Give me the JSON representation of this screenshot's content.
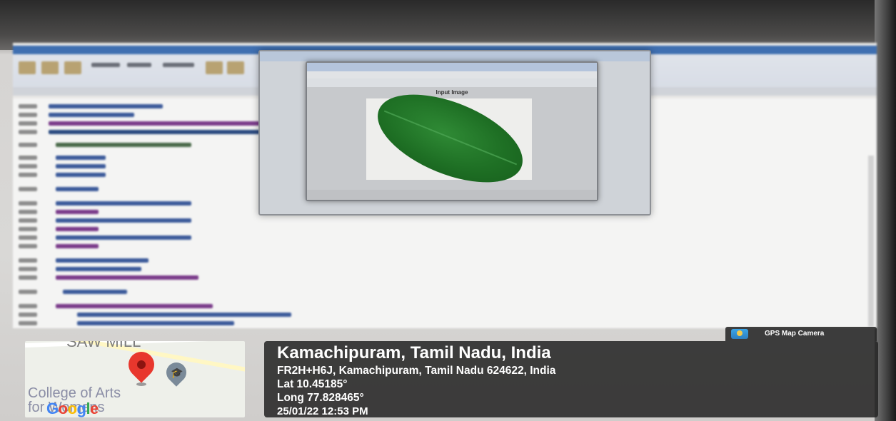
{
  "figure": {
    "axes_title": "Input Image"
  },
  "stamp": {
    "app_badge": "GPS Map Camera",
    "location_title": "Kamachipuram, Tamil Nadu, India",
    "address": "FR2H+H6J, Kamachipuram, Tamil Nadu 624622, India",
    "lat": "Lat 10.45185°",
    "long": "Long 77.828465°",
    "datetime": "25/01/22 12:53 PM"
  },
  "map": {
    "label_top": "SAW MILL",
    "label_college_1": "College of Arts",
    "label_college_2": "for Womens",
    "google_letters": [
      "G",
      "o",
      "o",
      "g",
      "l",
      "e"
    ]
  },
  "colors": {
    "pin": "#e8372d",
    "leaf": "#1e6f24",
    "overlay_bg": "#232323"
  }
}
